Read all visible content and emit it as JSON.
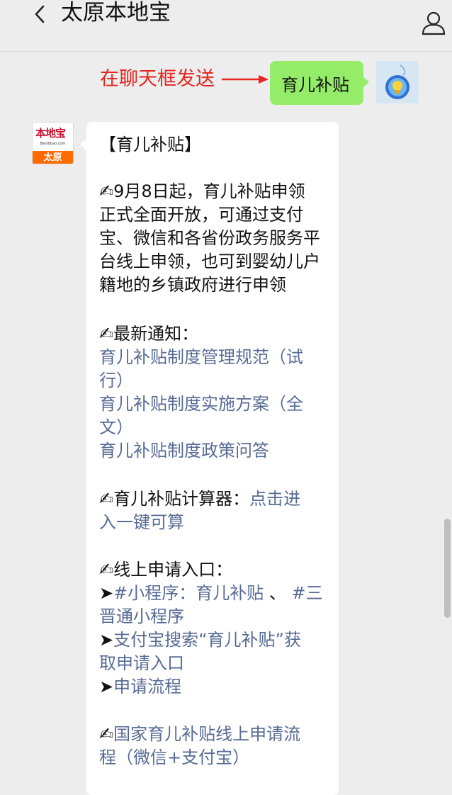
{
  "header": {
    "title": "太原本地宝"
  },
  "annotation": {
    "text": "在聊天框发送",
    "color": "#e5251e"
  },
  "sent_message": {
    "text": "育儿补贴"
  },
  "bot_avatar": {
    "brand": "本地宝",
    "domain": "Bendibao.com",
    "city": "太原"
  },
  "message": {
    "heading": "【育儿补贴】",
    "intro": {
      "icon": "✍",
      "lines": [
        "9月8日起，育儿补贴申领",
        "正式全面开放，可通过支付",
        "宝、微信和各省份政务服务平",
        "台线上申领，也可到婴幼儿户",
        "籍地的乡镇政府进行申领"
      ]
    },
    "notice": {
      "icon": "✍",
      "label": "最新通知：",
      "links": [
        [
          "育儿补贴制度管理规范（试",
          "行）"
        ],
        [
          "育儿补贴制度实施方案（全",
          "文）"
        ],
        [
          "育儿补贴制度政策问答"
        ]
      ]
    },
    "calculator": {
      "icon": "✍",
      "label": "育儿补贴计算器：",
      "link_part1": "点击进",
      "link_part2": "入一键可算"
    },
    "entry": {
      "icon": "✍",
      "label": "线上申请入口：",
      "bullet": "➤",
      "item1_part1": "#小程序：育儿补贴",
      "item1_sep": " 、 ",
      "item1_part2": "#三",
      "item1_part3": "晋通小程序",
      "item2_part1": "支付宝搜索“育儿补贴”获",
      "item2_part2": "取申请入口",
      "item3": "申请流程"
    },
    "national": {
      "icon": "✍",
      "line1": "国家育儿补贴线上申请流",
      "line2": "程（微信+支付宝）"
    }
  },
  "colors": {
    "link": "#576b95",
    "sent_bubble": "#95ec69",
    "background": "#ededed"
  }
}
